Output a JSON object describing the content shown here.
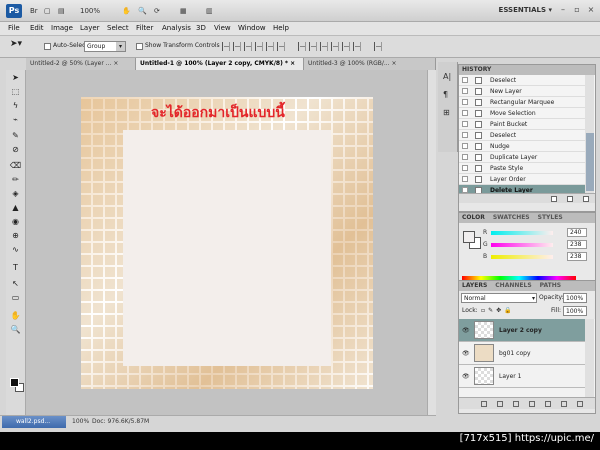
{
  "app": {
    "logo": "Ps",
    "zoom": "100%",
    "workspace": "ESSENTIALS",
    "workspace_arrow": "▾",
    "min": "–",
    "max": "▫",
    "close": "×",
    "appbar_icons": [
      "Br",
      "▢",
      "▤",
      "✋",
      "🔍",
      "⟳",
      "▦",
      "▥"
    ]
  },
  "menu": [
    "File",
    "Edit",
    "Image",
    "Layer",
    "Select",
    "Filter",
    "Analysis",
    "3D",
    "View",
    "Window",
    "Help"
  ],
  "options": {
    "auto_select_label": "Auto-Select:",
    "auto_select_value": "Group",
    "show_transform_label": "Show Transform Controls"
  },
  "tabs": [
    {
      "label": "Untitled-2 @ 50% (Layer ...",
      "close": "×"
    },
    {
      "label": "Untitled-1 @ 100% (Layer 2 copy, CMYK/8) *",
      "close": "×"
    },
    {
      "label": "Untitled-3 @ 100% (RGB/...",
      "close": "×"
    }
  ],
  "tools": [
    "➤",
    "⬚",
    "ϟ",
    "⌁",
    "✎",
    "⊘",
    "⌫",
    "✏",
    "◈",
    "▲",
    "◉",
    "⊕",
    "∿",
    "T",
    "↖",
    "▭",
    "✋",
    "🔍"
  ],
  "document": {
    "text": "จะได้ออกมาเป็นแบบนี้"
  },
  "status": {
    "zoom": "100%",
    "doc": "Doc: 976.6K/5.87M"
  },
  "taskbar": {
    "label": "wall2.psd..."
  },
  "dock_icons": [
    "A|",
    "¶",
    "⊞"
  ],
  "history": {
    "title": "HISTORY",
    "items": [
      "Deselect",
      "New Layer",
      "Rectangular Marquee",
      "Move Selection",
      "Paint Bucket",
      "Deselect",
      "Nudge",
      "Duplicate Layer",
      "Paste Style",
      "Layer Order",
      "Delete Layer"
    ],
    "selected_index": 10
  },
  "color": {
    "tabs": [
      "COLOR",
      "SWATCHES",
      "STYLES"
    ],
    "channels": [
      {
        "label": "R",
        "value": "240"
      },
      {
        "label": "G",
        "value": "238"
      },
      {
        "label": "B",
        "value": "238"
      }
    ]
  },
  "layers": {
    "tabs": [
      "LAYERS",
      "CHANNELS",
      "PATHS"
    ],
    "blend": "Normal",
    "opacity_label": "Opacity:",
    "opacity": "100%",
    "lock_label": "Lock:",
    "fill_label": "Fill:",
    "fill": "100%",
    "items": [
      {
        "name": "Layer 2 copy",
        "selected": true
      },
      {
        "name": "bg01 copy",
        "selected": false
      },
      {
        "name": "Layer 1",
        "selected": false
      }
    ]
  },
  "watermark": "[717x515] https://upic.me/"
}
